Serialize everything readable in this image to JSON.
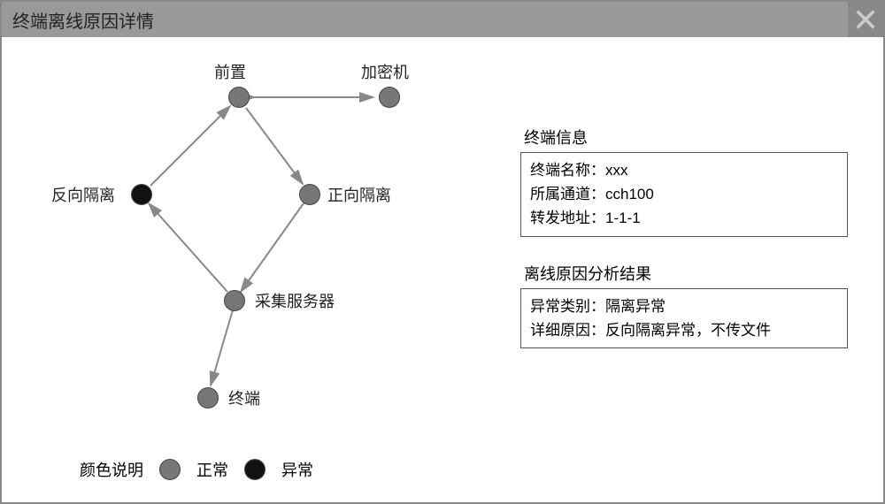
{
  "window": {
    "title": "终端离线原因详情"
  },
  "nodes": {
    "front": {
      "label": "前置",
      "status": "normal"
    },
    "crypto": {
      "label": "加密机",
      "status": "normal"
    },
    "revIso": {
      "label": "反向隔离",
      "status": "abnormal"
    },
    "fwdIso": {
      "label": "正向隔离",
      "status": "normal"
    },
    "collector": {
      "label": "采集服务器",
      "status": "normal"
    },
    "terminal": {
      "label": "终端",
      "status": "normal"
    }
  },
  "legend": {
    "title": "颜色说明",
    "items": [
      {
        "key": "normal",
        "label": "正常"
      },
      {
        "key": "abnormal",
        "label": "异常"
      }
    ]
  },
  "info": {
    "terminalHeading": "终端信息",
    "terminalNameLabel": "终端名称：",
    "terminalNameValue": "xxx",
    "channelLabel": "所属通道：",
    "channelValue": "cch100",
    "forwardAddrLabel": "转发地址：",
    "forwardAddrValue": "1-1-1",
    "analysisHeading": "离线原因分析结果",
    "categoryLabel": "异常类别：",
    "categoryValue": "隔离异常",
    "detailLabel": "详细原因：",
    "detailValue": "反向隔离异常，不传文件"
  }
}
